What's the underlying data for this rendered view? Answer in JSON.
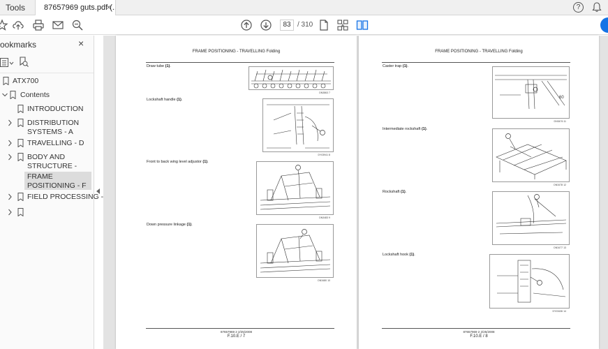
{
  "tabs": {
    "tools": "Tools",
    "document": "87657969 guts.pdf (...",
    "close": "×"
  },
  "toolbar": {
    "current_page": "83",
    "total_pages": "/ 310"
  },
  "sidebar": {
    "title": "ookmarks",
    "close": "×",
    "items": [
      {
        "label": "ATX700"
      },
      {
        "label": "Contents"
      },
      {
        "label": "INTRODUCTION"
      },
      {
        "label": "DISTRIBUTION SYSTEMS - A"
      },
      {
        "label": "TRAVELLING - D"
      },
      {
        "label": "BODY AND STRUCTURE - E"
      },
      {
        "label": "FRAME POSITIONING - F"
      },
      {
        "label": "FIELD PROCESSING - L"
      }
    ]
  },
  "pages": {
    "left": {
      "header": "FRAME POSITIONING - TRAVELLING Folding",
      "figures": [
        {
          "caption_text": "Draw tube ",
          "caption_num": "(1)",
          "caption_end": ".",
          "fig_id": "DN3863   7"
        },
        {
          "caption_text": "Lockshaft handle ",
          "caption_num": "(1)",
          "caption_end": ".",
          "fig_id": "DY03941   8"
        },
        {
          "caption_text": "Front to back wing level adjustor ",
          "caption_num": "(1)",
          "caption_end": ".",
          "fig_id": "DN3483   9"
        },
        {
          "caption_text": "Down pressure linkage ",
          "caption_num": "(1)",
          "caption_end": ".",
          "fig_id": "DN3480   10"
        }
      ],
      "footer_doc": "87657969 2 2/25/2008",
      "footer_page": "F.10.E / 7"
    },
    "right": {
      "header": "FRAME POSITIONING - TRAVELLING Folding",
      "figures": [
        {
          "caption_text": "Caster trap ",
          "caption_num": "(1)",
          "caption_end": ".",
          "fig_id": "DN3476   11"
        },
        {
          "caption_text": "Intermediate rockshaft ",
          "caption_num": "(1)",
          "caption_end": ".",
          "fig_id": "DN3478   12"
        },
        {
          "caption_text": "Rockshaft ",
          "caption_num": "(1)",
          "caption_end": ".",
          "fig_id": "DN3477   13"
        },
        {
          "caption_text": "Lockshaft hook ",
          "caption_num": "(1)",
          "caption_end": ".",
          "fig_id": "DY03436   14"
        }
      ],
      "footer_doc": "87657969 2 2/25/2008",
      "footer_page": "F.10.E / 8"
    }
  },
  "colors": {
    "accent": "#1473e6",
    "doc_background": "#e3e3e3",
    "selected_bookmark": "#dcdcdc"
  },
  "icons": [
    "star-icon",
    "upload-icon",
    "print-icon",
    "mail-icon",
    "zoom-search-icon",
    "arrow-up-icon",
    "arrow-down-icon",
    "page-icon",
    "scroll-mode-icon",
    "two-page-icon",
    "help-icon",
    "bell-icon",
    "bookmark-icon",
    "chevron-right-icon",
    "chevron-down-icon"
  ]
}
